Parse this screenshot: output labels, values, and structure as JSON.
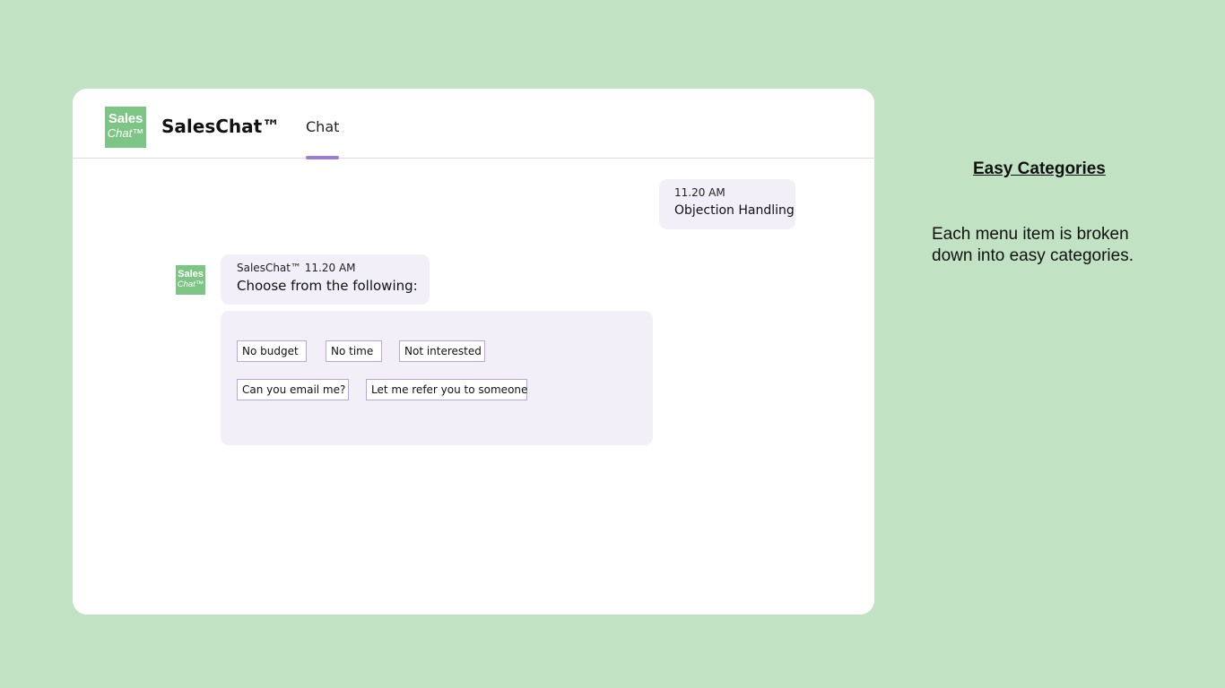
{
  "app": {
    "logo_line1": "Sales",
    "logo_line2": "Chat™",
    "title": "SalesChat™"
  },
  "tabs": [
    {
      "label": "Chat",
      "active": true
    }
  ],
  "messages": {
    "user": {
      "time": "11.20 AM",
      "text": "Objection Handling"
    },
    "bot": {
      "meta": "SalesChat™ 11.20 AM",
      "text": "Choose from the following:",
      "avatar_line1": "Sales",
      "avatar_line2": "Chat™"
    }
  },
  "options": [
    "No budget",
    "No time",
    "Not interested",
    "Can you email me?",
    "Let me refer you to someone"
  ],
  "annotation": {
    "heading": "Easy Categories",
    "text": "Each menu item is broken down into easy categories."
  },
  "colors": {
    "background": "#c1e3c4",
    "brand_green": "#7dc584",
    "accent_purple": "#9b7dd4",
    "bubble": "#f2eff9"
  }
}
